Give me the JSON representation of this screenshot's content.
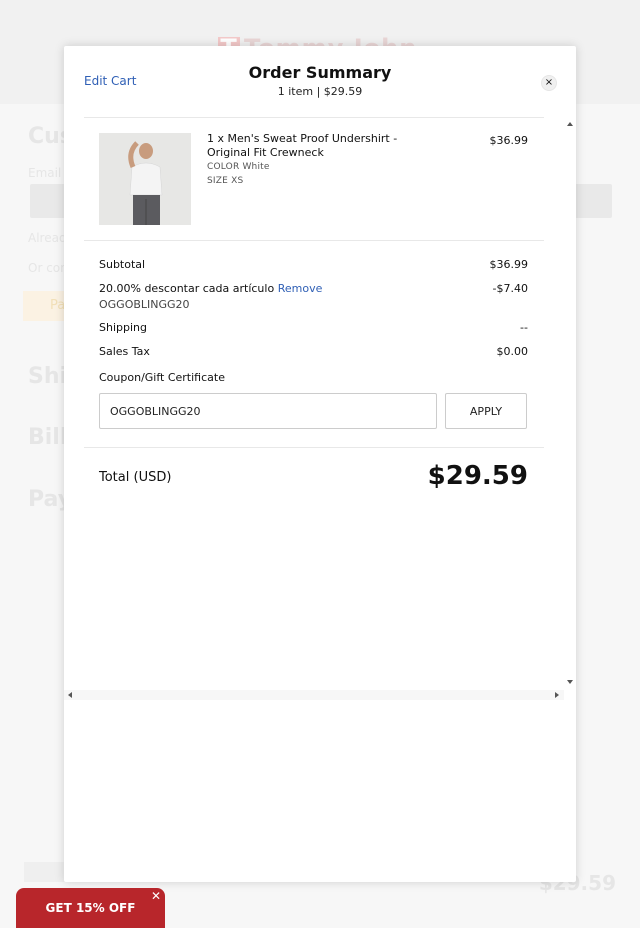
{
  "background": {
    "logo_mark": "T",
    "logo_text": "Tommy John",
    "section_customer": "Cus",
    "email_label": "Email",
    "already_text": "Alread",
    "or_text": "Or con",
    "pay_button": "Pa",
    "section_shipping": "Ship",
    "section_billing": "Bill",
    "section_payment": "Pay",
    "total": "$29.59"
  },
  "modal": {
    "edit_cart_label": "Edit Cart",
    "title": "Order Summary",
    "subtitle": "1 item | $29.59",
    "close_label": "×"
  },
  "product": {
    "name": "1 x Men's Sweat Proof Undershirt - Original Fit Crewneck",
    "color_line": "COLOR White",
    "size_line": "SIZE XS",
    "price": "$36.99"
  },
  "summary": {
    "subtotal_label": "Subtotal",
    "subtotal_value": "$36.99",
    "discount_label": "20.00% descontar cada artículo",
    "remove_label": "Remove",
    "discount_value": "-$7.40",
    "discount_code": "OGGOBLINGG20",
    "shipping_label": "Shipping",
    "shipping_value": "--",
    "tax_label": "Sales Tax",
    "tax_value": "$0.00",
    "coupon_label": "Coupon/Gift Certificate",
    "coupon_value": "OGGOBLINGG20",
    "apply_label": "APPLY",
    "total_label": "Total (USD)",
    "total_value": "$29.59"
  },
  "promo": {
    "label": "GET 15% OFF",
    "close_label": "✕"
  },
  "colors": {
    "link": "#2f5fb5",
    "promo": "#b8262b"
  }
}
